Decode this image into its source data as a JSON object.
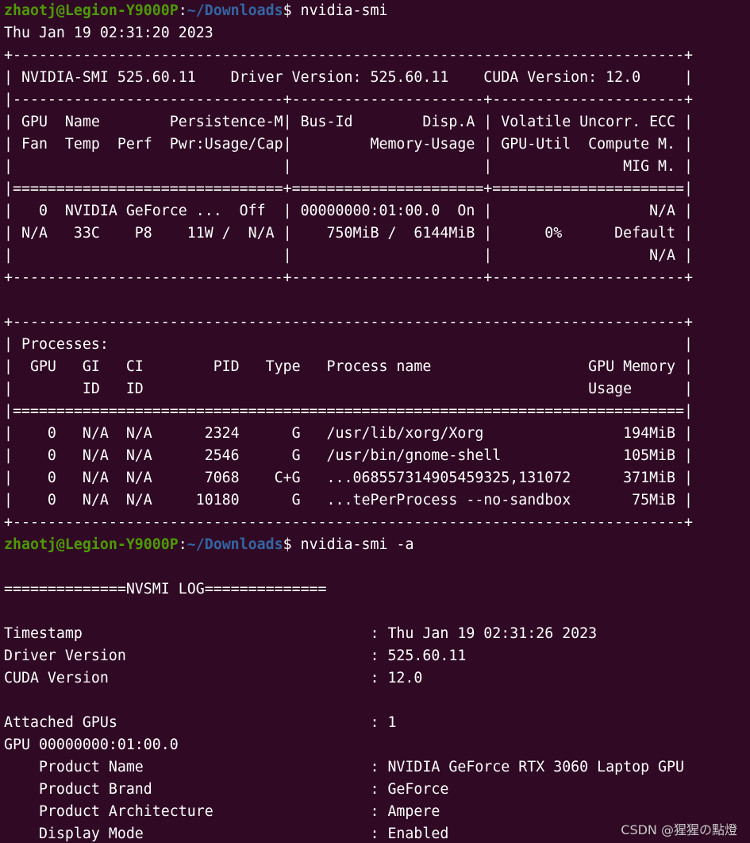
{
  "colors": {
    "background": "#300a24",
    "text": "#ffffff",
    "prompt_user_host": "#4e9a06",
    "prompt_path": "#3465a4"
  },
  "prompt1": {
    "user_host": "zhaotj@Legion-Y9000P",
    "sep": ":",
    "path": "~/Downloads",
    "symbol": "$",
    "command": " nvidia-smi"
  },
  "prompt2": {
    "user_host": "zhaotj@Legion-Y9000P",
    "sep": ":",
    "path": "~/Downloads",
    "symbol": "$",
    "command": " nvidia-smi -a"
  },
  "lines_block1": [
    "Thu Jan 19 02:31:20 2023",
    "+-----------------------------------------------------------------------------+",
    "| NVIDIA-SMI 525.60.11    Driver Version: 525.60.11    CUDA Version: 12.0     |",
    "|-------------------------------+----------------------+----------------------+",
    "| GPU  Name        Persistence-M| Bus-Id        Disp.A | Volatile Uncorr. ECC |",
    "| Fan  Temp  Perf  Pwr:Usage/Cap|         Memory-Usage | GPU-Util  Compute M. |",
    "|                               |                      |               MIG M. |",
    "|===============================+======================+======================|",
    "|   0  NVIDIA GeForce ...  Off  | 00000000:01:00.0  On |                  N/A |",
    "| N/A   33C    P8    11W /  N/A |    750MiB /  6144MiB |      0%      Default |",
    "|                               |                      |                  N/A |",
    "+-------------------------------+----------------------+----------------------+",
    "",
    "+-----------------------------------------------------------------------------+",
    "| Processes:                                                                  |",
    "|  GPU   GI   CI        PID   Type   Process name                  GPU Memory |",
    "|        ID   ID                                                   Usage      |",
    "|=============================================================================|",
    "|    0   N/A  N/A      2324      G   /usr/lib/xorg/Xorg                194MiB |",
    "|    0   N/A  N/A      2546      G   /usr/bin/gnome-shell              105MiB |",
    "|    0   N/A  N/A      7068    C+G   ...068557314905459325,131072      371MiB |",
    "|    0   N/A  N/A     10180      G   ...tePerProcess --no-sandbox       75MiB |",
    "+-----------------------------------------------------------------------------+"
  ],
  "lines_block2": [
    "",
    "==============NVSMI LOG==============",
    "",
    "Timestamp                                 : Thu Jan 19 02:31:26 2023",
    "Driver Version                            : 525.60.11",
    "CUDA Version                              : 12.0",
    "",
    "Attached GPUs                             : 1",
    "GPU 00000000:01:00.0",
    "    Product Name                          : NVIDIA GeForce RTX 3060 Laptop GPU",
    "    Product Brand                         : GeForce",
    "    Product Architecture                  : Ampere",
    "    Display Mode                          : Enabled"
  ],
  "watermark": "CSDN @猩猩の點燈"
}
